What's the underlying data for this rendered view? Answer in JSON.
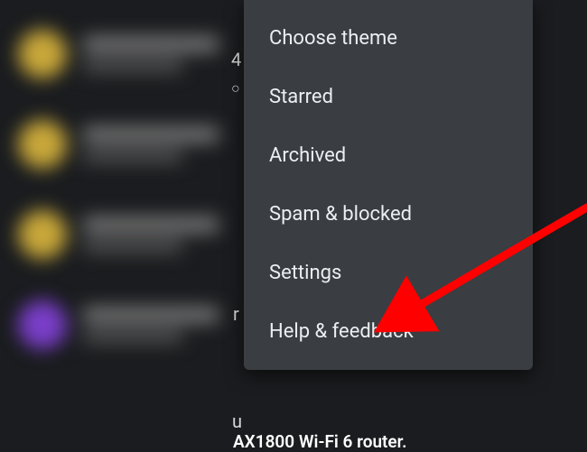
{
  "menu": {
    "items": [
      {
        "label": "Choose theme"
      },
      {
        "label": "Starred"
      },
      {
        "label": "Archived"
      },
      {
        "label": "Spam & blocked"
      },
      {
        "label": "Settings"
      },
      {
        "label": "Help & feedback"
      }
    ]
  },
  "background": {
    "fragments": {
      "digit": "4",
      "circle": "○",
      "r": "r",
      "u": "u"
    },
    "bottom_caption": "AX1800 Wi-Fi 6 router.",
    "avatars": [
      {
        "color": "yellow"
      },
      {
        "color": "yellow"
      },
      {
        "color": "yellow"
      },
      {
        "color": "purple"
      }
    ]
  },
  "annotation": {
    "color": "#ff0000",
    "target": "settings"
  }
}
